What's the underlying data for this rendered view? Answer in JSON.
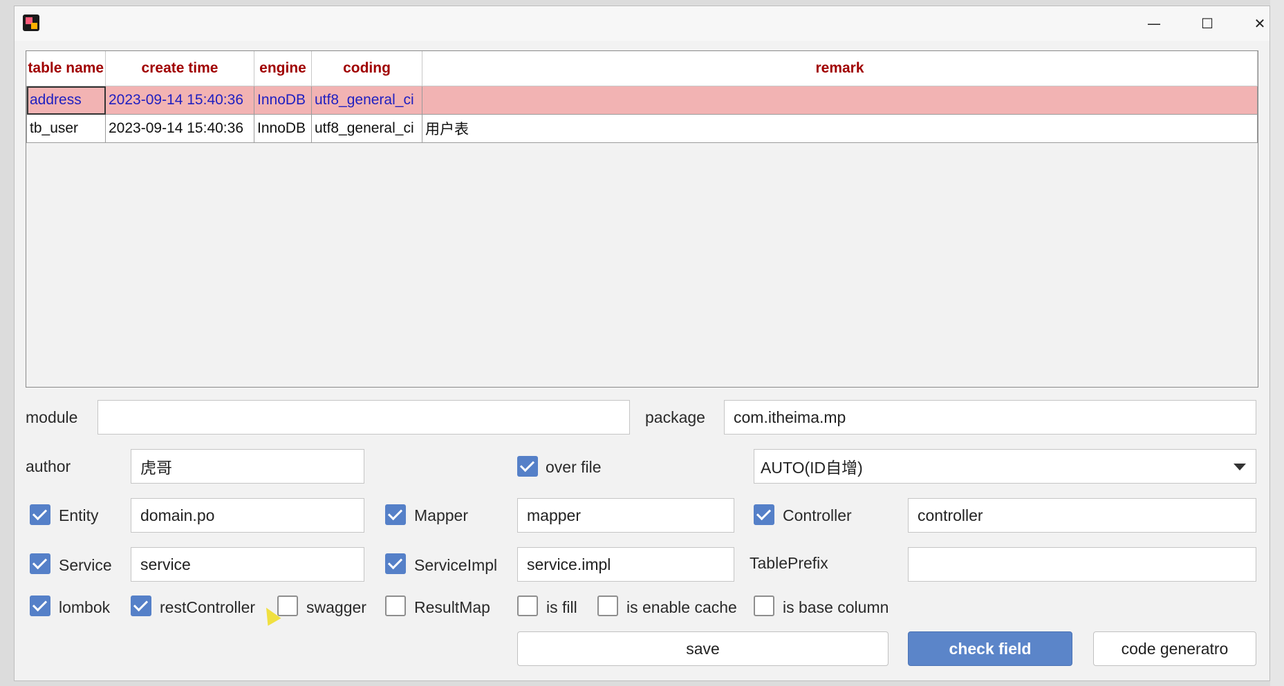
{
  "window": {
    "controls": {
      "minimize": "—",
      "maximize": "☐",
      "close": "✕"
    }
  },
  "table": {
    "headers": [
      "table name",
      "create time",
      "engine",
      "coding",
      "remark"
    ],
    "rows": [
      [
        "address",
        "2023-09-14 15:40:36",
        "InnoDB",
        "utf8_general_ci",
        ""
      ],
      [
        "tb_user",
        "2023-09-14 15:40:36",
        "InnoDB",
        "utf8_general_ci",
        "用户表"
      ]
    ],
    "selected_row": 0
  },
  "form": {
    "module_label": "module",
    "module_value": "",
    "package_label": "package",
    "package_value": "com.itheima.mp",
    "author_label": "author",
    "author_value": "虎哥",
    "over_file_label": "over file",
    "over_file_checked": true,
    "id_type_value": "AUTO(ID自增)",
    "entity_label": "Entity",
    "entity_checked": true,
    "entity_value": "domain.po",
    "mapper_label": "Mapper",
    "mapper_checked": true,
    "mapper_value": "mapper",
    "controller_label": "Controller",
    "controller_checked": true,
    "controller_value": "controller",
    "service_label": "Service",
    "service_checked": true,
    "service_value": "service",
    "serviceimpl_label": "ServiceImpl",
    "serviceimpl_checked": true,
    "serviceimpl_value": "service.impl",
    "tableprefix_label": "TablePrefix",
    "tableprefix_value": "",
    "options": [
      {
        "label": "lombok",
        "checked": true
      },
      {
        "label": "restController",
        "checked": true
      },
      {
        "label": "swagger",
        "checked": false
      },
      {
        "label": "ResultMap",
        "checked": false
      },
      {
        "label": "is fill",
        "checked": false
      },
      {
        "label": "is enable cache",
        "checked": false
      },
      {
        "label": "is base column",
        "checked": false
      }
    ]
  },
  "buttons": {
    "save": "save",
    "check_field": "check field",
    "code_generator": "code generatro"
  }
}
